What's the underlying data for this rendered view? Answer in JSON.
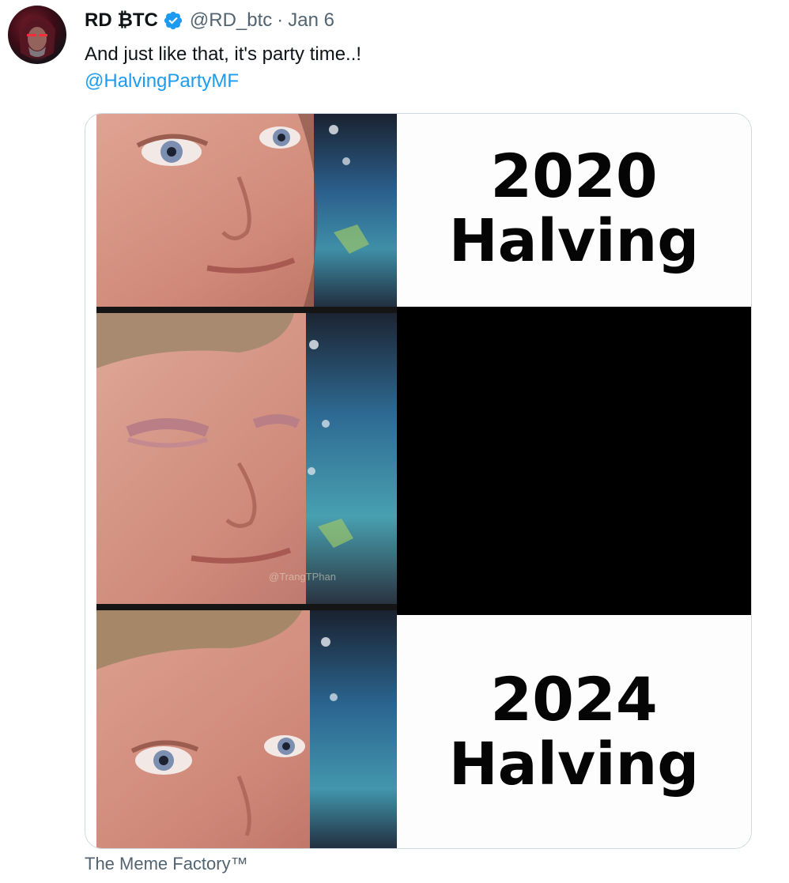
{
  "tweet": {
    "display_name": "RD ₿TC",
    "verified_icon": "verified-badge-icon",
    "handle": "@RD_btc",
    "separator": "·",
    "date": "Jan 6",
    "text": "And just like that, it's party time..!",
    "mention": "@HalvingPartyMF",
    "source": "The Meme Factory™"
  },
  "meme": {
    "top_caption_year": "2020",
    "top_caption_word": "Halving",
    "bottom_caption_year": "2024",
    "bottom_caption_word": "Halving",
    "watermark": "@TrangTPhan"
  },
  "colors": {
    "link": "#1d9bf0",
    "secondary_text": "#536471",
    "verified": "#1d9bf0",
    "border": "#cfd9de"
  }
}
